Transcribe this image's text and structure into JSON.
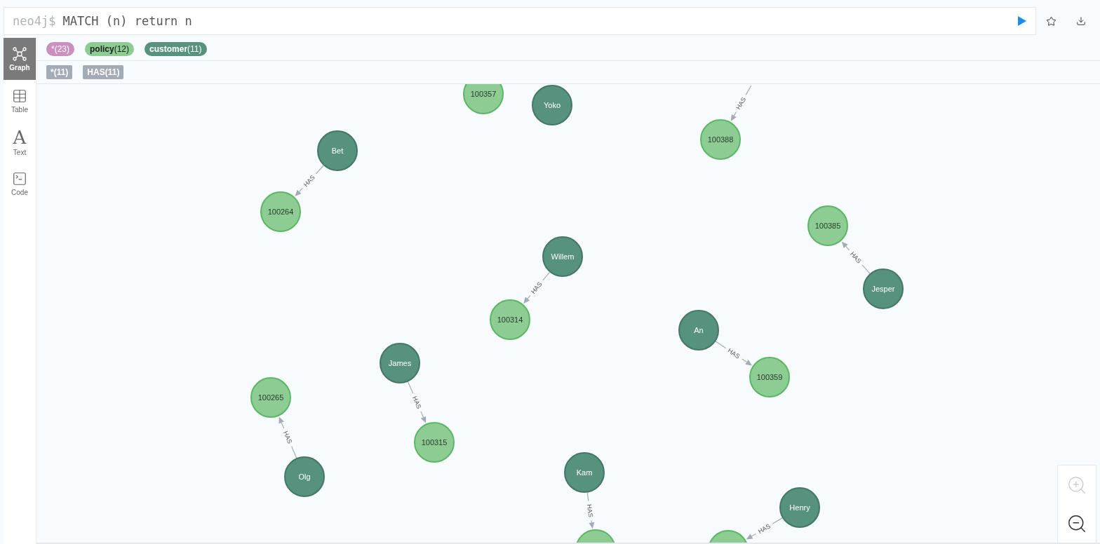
{
  "editor": {
    "prompt": "neo4j$",
    "query": "MATCH (n) return n"
  },
  "sidebar": [
    {
      "kind": "graph",
      "label": "Graph",
      "selected": true
    },
    {
      "kind": "table",
      "label": "Table",
      "selected": false
    },
    {
      "kind": "text",
      "glyph": "A",
      "label": "Text",
      "selected": false
    },
    {
      "kind": "code",
      "label": "Code",
      "selected": false
    }
  ],
  "node_labels": [
    {
      "text": "*(23)",
      "color": "#c990c0"
    },
    {
      "text": "**policy**(12)",
      "color": "#8dcc93"
    },
    {
      "text": "**customer**(11)",
      "color": "#57927f"
    }
  ],
  "relationship_types": [
    {
      "text": "*(11)"
    },
    {
      "text": "HAS(11)"
    }
  ],
  "graph": {
    "nodes": [
      {
        "kind": "policy",
        "label": "100357"
      },
      {
        "kind": "customer",
        "label": "Yoko"
      },
      {
        "kind": "policy",
        "label": "100388"
      },
      {
        "kind": "customer",
        "label": "Bet"
      },
      {
        "kind": "policy",
        "label": "100264"
      },
      {
        "kind": "policy",
        "label": "100385"
      },
      {
        "kind": "customer",
        "label": "Willem"
      },
      {
        "kind": "customer",
        "label": "Jesper"
      },
      {
        "kind": "policy",
        "label": "100314"
      },
      {
        "kind": "customer",
        "label": "An"
      },
      {
        "kind": "customer",
        "label": "James"
      },
      {
        "kind": "policy",
        "label": "100359"
      },
      {
        "kind": "policy",
        "label": "100265"
      },
      {
        "kind": "policy",
        "label": "100315"
      },
      {
        "kind": "customer",
        "label": "Kam"
      },
      {
        "kind": "customer",
        "label": "Olg"
      },
      {
        "kind": "customer",
        "label": "Henry"
      },
      {
        "kind": "policy"
      },
      {
        "kind": "policy"
      }
    ],
    "edges": [
      {
        "label": "HAS"
      },
      {
        "label": "HAS"
      },
      {
        "label": "HAS"
      },
      {
        "label": "HAS"
      },
      {
        "label": "HAS"
      },
      {
        "label": "HAS"
      },
      {
        "label": "HAS"
      },
      {
        "label": "HAS"
      },
      {
        "label": "HAS"
      }
    ]
  }
}
